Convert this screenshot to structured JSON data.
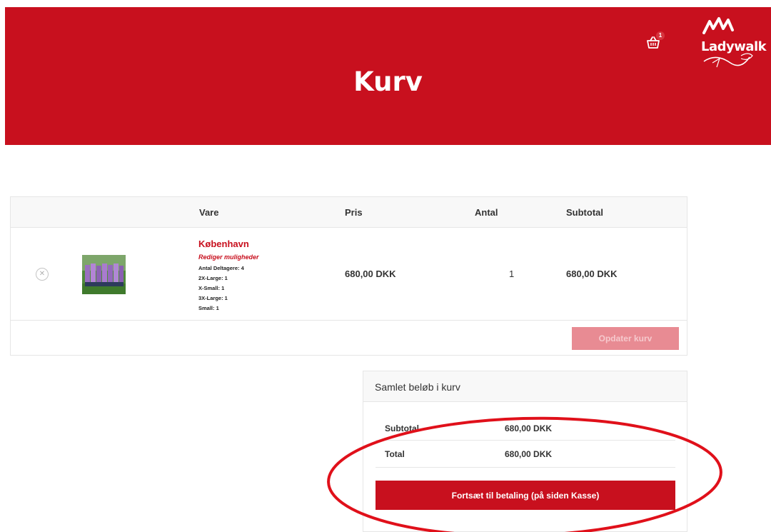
{
  "header": {
    "title": "Kurv",
    "cart_count": "1",
    "logo_text": "Ladywalk"
  },
  "colors": {
    "brand_red": "#c8101e",
    "annotation_red": "#e0101a"
  },
  "cart": {
    "columns": [
      "Vare",
      "Pris",
      "Antal",
      "Subtotal"
    ],
    "items": [
      {
        "name": "København",
        "edit_link": "Rediger muligheder",
        "meta": [
          "Antal Deltagere: 4",
          "2X-Large: 1",
          "X-Small: 1",
          "3X-Large: 1",
          "Small: 1"
        ],
        "price": "680,00 DKK",
        "quantity": "1",
        "subtotal": "680,00 DKK"
      }
    ],
    "update_button": "Opdater kurv"
  },
  "totals": {
    "heading": "Samlet beløb i kurv",
    "subtotal_label": "Subtotal",
    "subtotal_value": "680,00 DKK",
    "total_label": "Total",
    "total_value": "680,00 DKK",
    "checkout_button": "Fortsæt til betaling (på siden Kasse)"
  },
  "icons": {
    "cart": "basket-icon",
    "remove": "close-icon",
    "logo": "ladywalk-logo"
  }
}
